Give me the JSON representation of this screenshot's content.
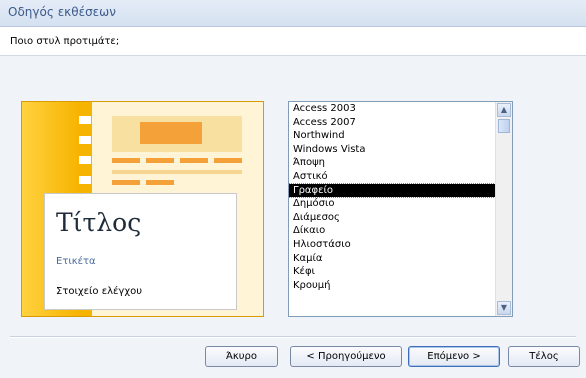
{
  "window": {
    "title": "Οδηγός εκθέσεων"
  },
  "prompt": {
    "question": "Ποιο στυλ προτιμάτε;"
  },
  "preview": {
    "title_text": "Τίτλος",
    "label_text": "Ετικέτα",
    "control_text": "Στοιχείο ελέγχου"
  },
  "styles_list": {
    "items": [
      "Access 2003",
      "Access 2007",
      "Northwind",
      "Windows Vista",
      "Άποψη",
      "Αστικό",
      "Γραφείο",
      "Δημόσιο",
      "Διάμεσος",
      "Δίκαιο",
      "Ηλιοστάσιο",
      "Καμία",
      "Κέφι",
      "Κρουμή"
    ],
    "selected": "Γραφείο"
  },
  "buttons": {
    "cancel": "Άκυρο",
    "back": "< Προηγούμενο",
    "next": "Επόμενο >",
    "finish": "Τέλος"
  },
  "colors": {
    "accent": "#f4b400",
    "selection": "#000000"
  }
}
